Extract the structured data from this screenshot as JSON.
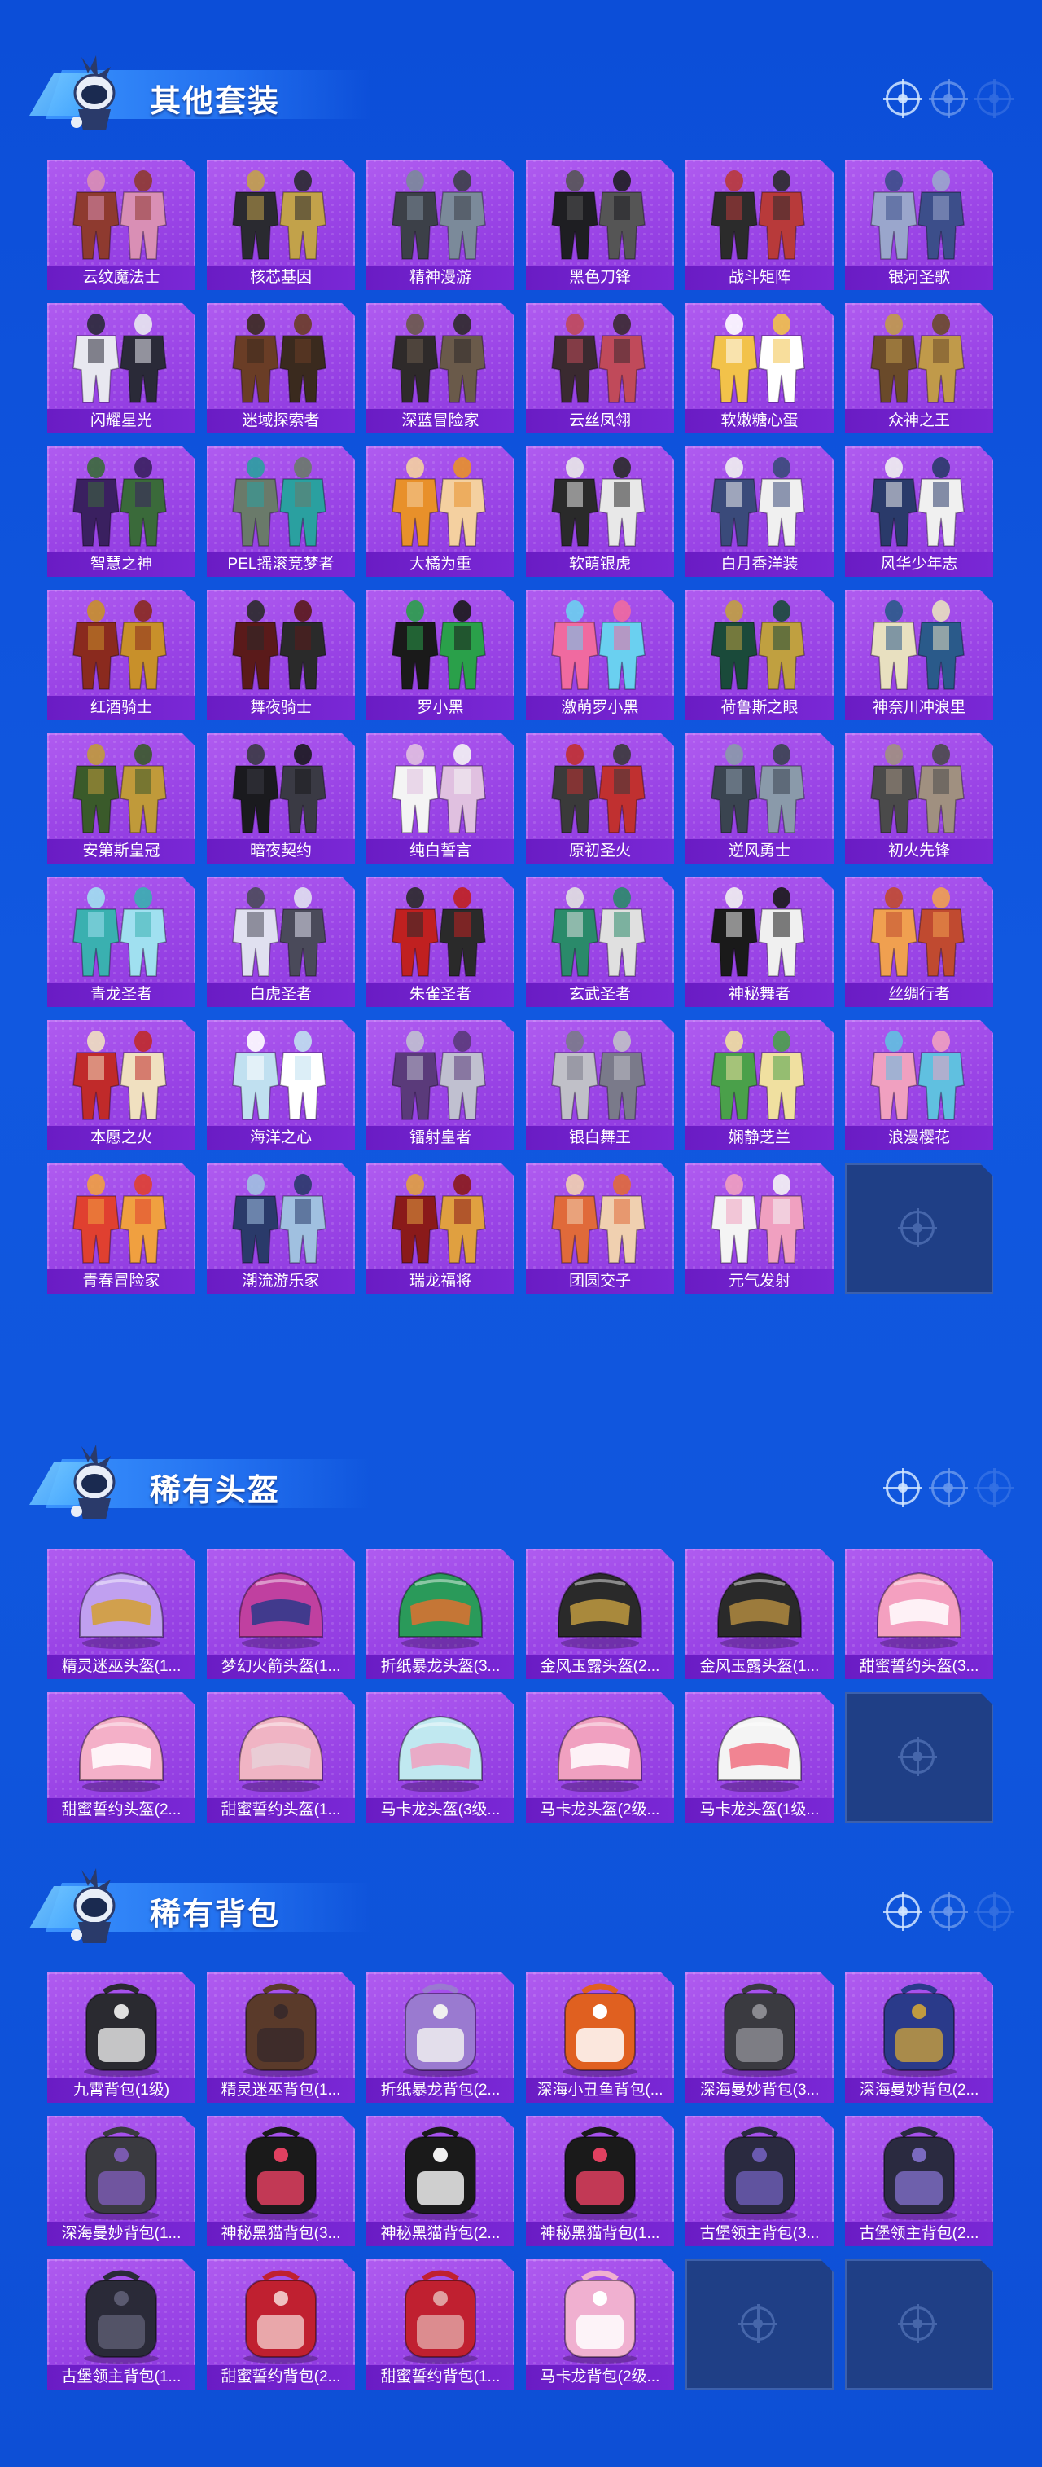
{
  "colors": {
    "background": "#0d4fd6",
    "card": "#a04ce8",
    "label_bar": "#6a1cc4",
    "empty_slot": "#1f3f86"
  },
  "sections": [
    {
      "title": "其他套装",
      "kind": "outfit",
      "items": [
        "云纹魔法士",
        "核芯基因",
        "精神漫游",
        "黑色刀锋",
        "战斗矩阵",
        "银河圣歌",
        "闪耀星光",
        "迷域探索者",
        "深蓝冒险家",
        "云丝凤翎",
        "软嫩糖心蛋",
        "众神之王",
        "智慧之神",
        "PEL摇滚竞梦者",
        "大橘为重",
        "软萌银虎",
        "白月香洋装",
        "风华少年志",
        "红酒骑士",
        "舞夜骑士",
        "罗小黑",
        "激萌罗小黑",
        "荷鲁斯之眼",
        "神奈川冲浪里",
        "安第斯皇冠",
        "暗夜契约",
        "纯白誓言",
        "原初圣火",
        "逆风勇士",
        "初火先锋",
        "青龙圣者",
        "白虎圣者",
        "朱雀圣者",
        "玄武圣者",
        "神秘舞者",
        "丝绸行者",
        "本愿之火",
        "海洋之心",
        "镭射皇者",
        "银白舞王",
        "娴静芝兰",
        "浪漫樱花",
        "青春冒险家",
        "潮流游乐家",
        "瑞龙福将",
        "团圆交子",
        "元气发射"
      ],
      "empty_slots": 1
    },
    {
      "title": "稀有头盔",
      "kind": "helmet",
      "items": [
        "精灵迷巫头盔(1...",
        "梦幻火箭头盔(1...",
        "折纸暴龙头盔(3...",
        "金风玉露头盔(2...",
        "金风玉露头盔(1...",
        "甜蜜誓约头盔(3...",
        "甜蜜誓约头盔(2...",
        "甜蜜誓约头盔(1...",
        "马卡龙头盔(3级...",
        "马卡龙头盔(2级...",
        "马卡龙头盔(1级..."
      ],
      "empty_slots": 1
    },
    {
      "title": "稀有背包",
      "kind": "backpack",
      "items": [
        "九霄背包(1级)",
        "精灵迷巫背包(1...",
        "折纸暴龙背包(2...",
        "深海小丑鱼背包(...",
        "深海曼妙背包(3...",
        "深海曼妙背包(2...",
        "深海曼妙背包(1...",
        "神秘黑猫背包(3...",
        "神秘黑猫背包(2...",
        "神秘黑猫背包(1...",
        "古堡领主背包(3...",
        "古堡领主背包(2...",
        "古堡领主背包(1...",
        "甜蜜誓约背包(2...",
        "甜蜜誓约背包(1...",
        "马卡龙背包(2级..."
      ],
      "empty_slots": 2
    }
  ],
  "icons": {
    "section_mascot": "mascot-icon",
    "section_targets": "crosshair-icon",
    "empty_slot": "crosshair-icon"
  }
}
